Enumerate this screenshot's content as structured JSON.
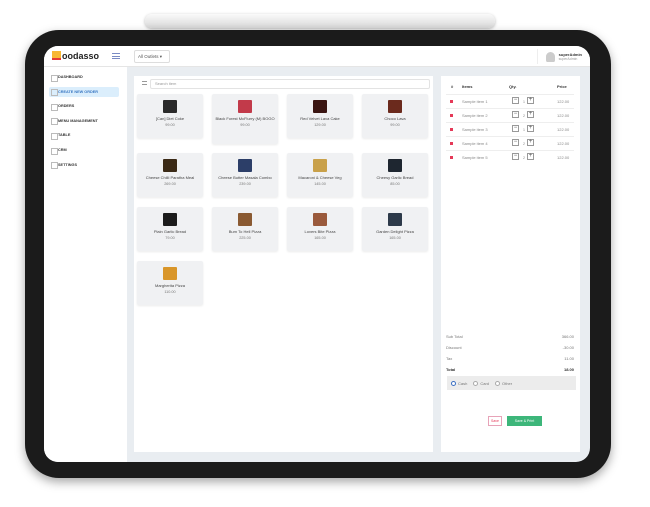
{
  "app": {
    "logo": "oodasso",
    "outlet": "All Outlets ▾",
    "user_name": "superAdmin",
    "user_role": "superAdmin"
  },
  "sidebar": {
    "items": [
      {
        "label": "DASHBOARD"
      },
      {
        "label": "CREATE NEW ORDER",
        "active": true
      },
      {
        "label": "ORDERS"
      },
      {
        "label": "MENU MANAGEMENT"
      },
      {
        "label": "TABLE"
      },
      {
        "label": "CRM"
      },
      {
        "label": "SETTINGS"
      }
    ]
  },
  "search": {
    "placeholder": "Search item"
  },
  "products": [
    {
      "name": "[Can] Diet Coke",
      "price": "99.00",
      "color": "#2a2a2a"
    },
    {
      "name": "Black Forest McFlurry (M) BOGO",
      "price": "99.00",
      "color": "#c23a4a"
    },
    {
      "name": "Red Velvet Lava Cake",
      "price": "129.00",
      "color": "#3a1512"
    },
    {
      "name": "Choco Lava",
      "price": "99.00",
      "color": "#6b2a1d"
    },
    {
      "name": "Cheese Chilli Paratha Meal",
      "price": "269.00",
      "color": "#3b2a16"
    },
    {
      "name": "Cheese Butter Masala Combo",
      "price": "239.00",
      "color": "#2c3e68"
    },
    {
      "name": "Macaroni & Cheese Veg",
      "price": "145.00",
      "color": "#c9a14a"
    },
    {
      "name": "Cheesy Garlic Bread",
      "price": "85.00",
      "color": "#1e2630"
    },
    {
      "name": "Plain Garlic Bread",
      "price": "79.00",
      "color": "#1c1c1c"
    },
    {
      "name": "Burn To Hell Pizza",
      "price": "225.00",
      "color": "#8a5a32"
    },
    {
      "name": "Lovers Bite Pizza",
      "price": "165.00",
      "color": "#9a5a3c"
    },
    {
      "name": "Garden Delight Pizza",
      "price": "165.00",
      "color": "#2d3a4a"
    },
    {
      "name": "Margherita Pizza",
      "price": "110.00",
      "color": "#d9962a"
    }
  ],
  "cart": {
    "headers": {
      "num": "#",
      "items": "Items",
      "qty": "Qty.",
      "price": "Price"
    },
    "rows": [
      {
        "name": "Sample item 1",
        "qty": "1",
        "price": "122.00"
      },
      {
        "name": "Sample item 2",
        "qty": "2",
        "price": "122.00"
      },
      {
        "name": "Sample item 3",
        "qty": "1",
        "price": "122.00"
      },
      {
        "name": "Sample item 4",
        "qty": "2",
        "price": "122.00"
      },
      {
        "name": "Sample item 5",
        "qty": "2",
        "price": "122.00"
      }
    ],
    "totals": [
      {
        "label": "Sub Total",
        "value": "366.00"
      },
      {
        "label": "Discount",
        "value": "-30.00"
      },
      {
        "label": "Tax",
        "value": "11.00"
      },
      {
        "label": "Total",
        "value": "18.00"
      }
    ],
    "payment": [
      "Cash",
      "Card",
      "Other"
    ],
    "save": "Save",
    "save_print": "Save & Print"
  }
}
